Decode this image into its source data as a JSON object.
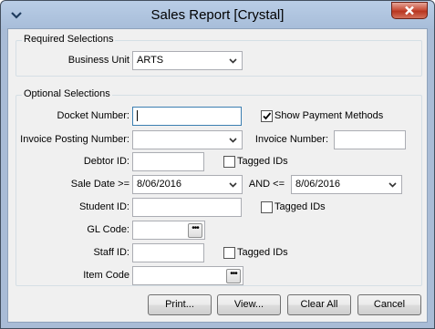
{
  "window": {
    "title": "Sales Report  [Crystal]"
  },
  "required": {
    "group_title": "Required Selections",
    "business_unit_label": "Business Unit",
    "business_unit_value": "ARTS"
  },
  "optional": {
    "group_title": "Optional Selections",
    "docket_number_label": "Docket Number:",
    "docket_number_value": "",
    "show_payment_methods_label": "Show Payment Methods",
    "show_payment_methods_checked": true,
    "invoice_posting_number_label": "Invoice Posting Number:",
    "invoice_posting_number_value": "",
    "invoice_number_label": "Invoice Number:",
    "invoice_number_value": "",
    "debtor_id_label": "Debtor ID:",
    "debtor_id_value": "",
    "debtor_tagged_label": "Tagged IDs",
    "sale_date_label": "Sale Date >=",
    "sale_date_from": "8/06/2016",
    "and_label": "AND <=",
    "sale_date_to": "8/06/2016",
    "student_id_label": "Student ID:",
    "student_id_value": "",
    "student_tagged_label": "Tagged IDs",
    "gl_code_label": "GL Code:",
    "gl_code_value": "",
    "staff_id_label": "Staff ID:",
    "staff_id_value": "",
    "staff_tagged_label": "Tagged IDs",
    "item_code_label": "Item Code",
    "item_code_value": ""
  },
  "buttons": {
    "print": "Print...",
    "view": "View...",
    "clear_all": "Clear All",
    "cancel": "Cancel"
  },
  "colors": {
    "title_bar": "#b3c7e1",
    "close_button": "#c9503b",
    "dialog_background": "#f0f0f0"
  },
  "icons": {
    "app": "chevron-down-app-icon",
    "close": "close-icon",
    "dropdown": "chevron-down-icon",
    "browse": "ellipsis-icon",
    "check": "check-icon"
  }
}
